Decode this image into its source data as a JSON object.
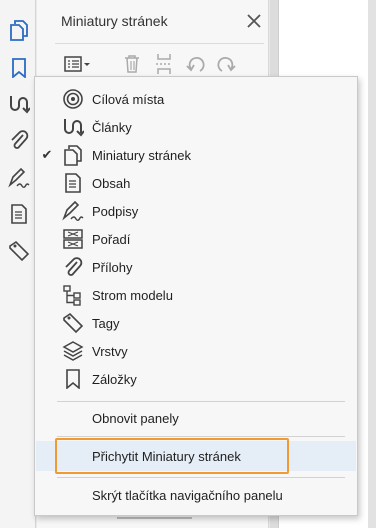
{
  "panel": {
    "title": "Miniatury stránek"
  },
  "nav_rail": {
    "items": [
      "page-thumbnails-icon",
      "bookmark-icon",
      "articles-icon",
      "attachment-icon",
      "signature-icon",
      "content-icon",
      "tags-icon"
    ]
  },
  "menu": {
    "items": [
      {
        "label": "Cílová místa",
        "icon": "destinations-icon",
        "checked": false
      },
      {
        "label": "Články",
        "icon": "articles-icon",
        "checked": false
      },
      {
        "label": "Miniatury stránek",
        "icon": "page-thumbnails-icon",
        "checked": true
      },
      {
        "label": "Obsah",
        "icon": "content-icon",
        "checked": false
      },
      {
        "label": "Podpisy",
        "icon": "signature-icon",
        "checked": false
      },
      {
        "label": "Pořadí",
        "icon": "order-icon",
        "checked": false
      },
      {
        "label": "Přílohy",
        "icon": "attachment-icon",
        "checked": false
      },
      {
        "label": "Strom modelu",
        "icon": "model-tree-icon",
        "checked": false
      },
      {
        "label": "Tagy",
        "icon": "tags-icon",
        "checked": false
      },
      {
        "label": "Vrstvy",
        "icon": "layers-icon",
        "checked": false
      },
      {
        "label": "Záložky",
        "icon": "bookmark-icon",
        "checked": false
      }
    ],
    "check_mark": "✔",
    "reset_label": "Obnovit panely",
    "dock_label": "Přichytit Miniatury stránek",
    "hide_label": "Skrýt tlačítka navigačního panelu"
  },
  "colors": {
    "accent_blue": "#2b6cc4",
    "focus_orange": "#f29a32",
    "highlight_bg": "#e5edf7"
  }
}
